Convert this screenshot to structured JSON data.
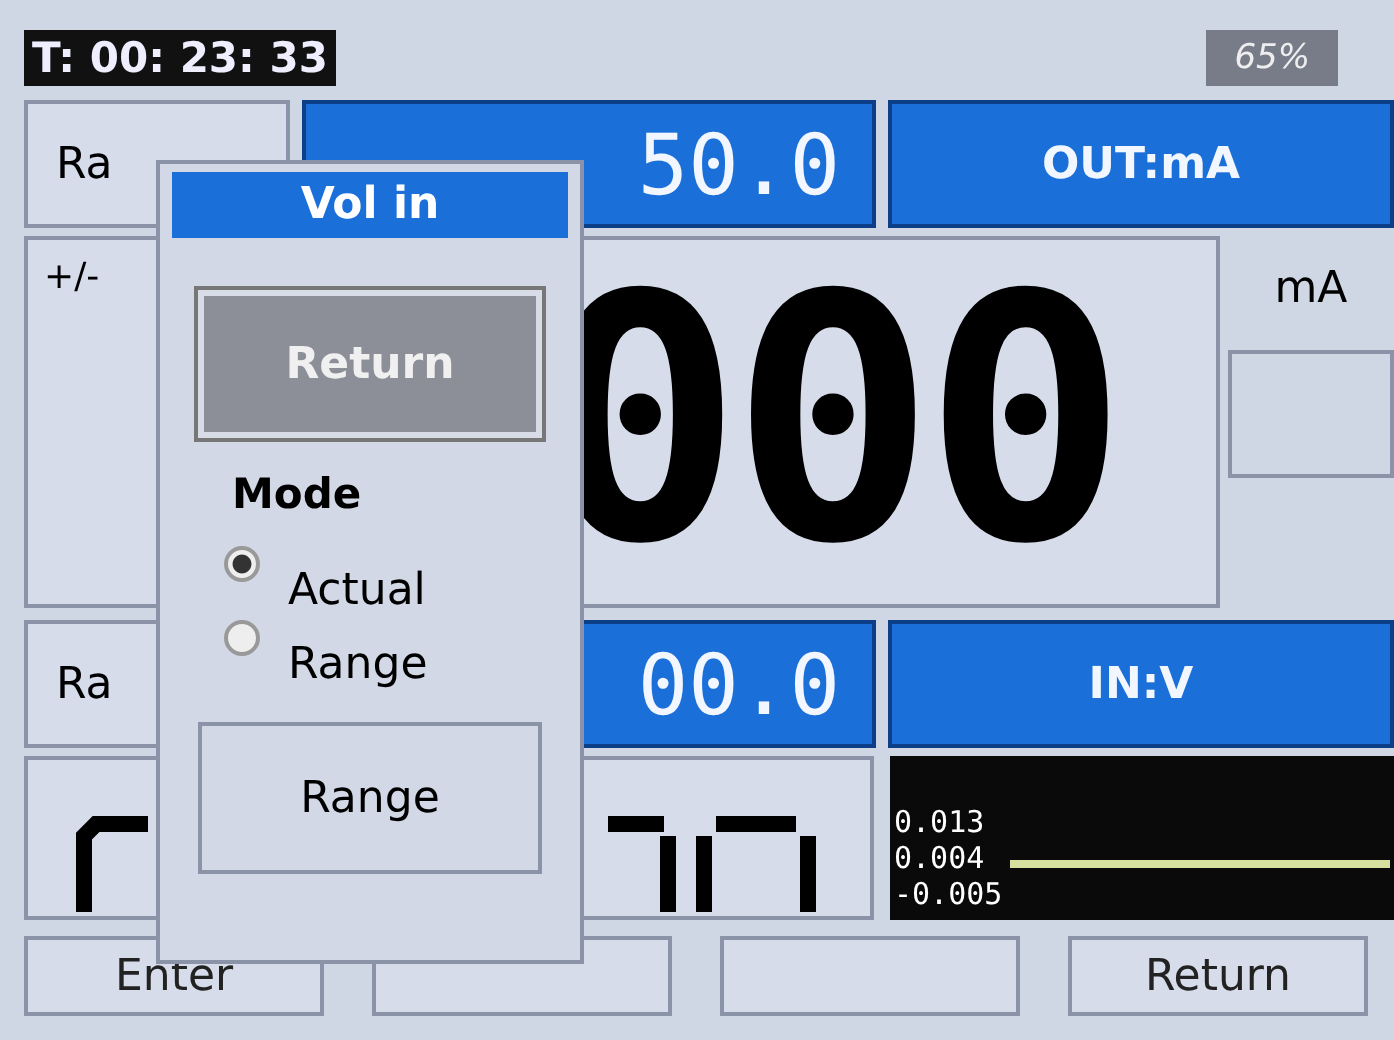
{
  "status_bar": {
    "timer": "T: 00: 23: 33",
    "battery": "65%"
  },
  "output": {
    "label": "Ra",
    "value": "50.0",
    "mode": "OUT:mA",
    "sign": "+/-",
    "reading": "000",
    "unit": "mA"
  },
  "input": {
    "label": "Ra",
    "value": "00.0",
    "mode": "IN:V",
    "trend_labels": [
      "0.013",
      "0.004",
      "-0.005"
    ]
  },
  "dialog": {
    "title": "Vol in",
    "return_button": "Return",
    "mode_label": "Mode",
    "options": [
      {
        "label": "Actual",
        "selected": true
      },
      {
        "label": "Range",
        "selected": false
      }
    ],
    "range_button": "Range"
  },
  "softkeys": [
    {
      "kind": "labeled",
      "label": "Enter"
    },
    {
      "kind": "blank"
    },
    {
      "kind": "blank"
    },
    {
      "kind": "labeled",
      "label": "Return"
    }
  ]
}
